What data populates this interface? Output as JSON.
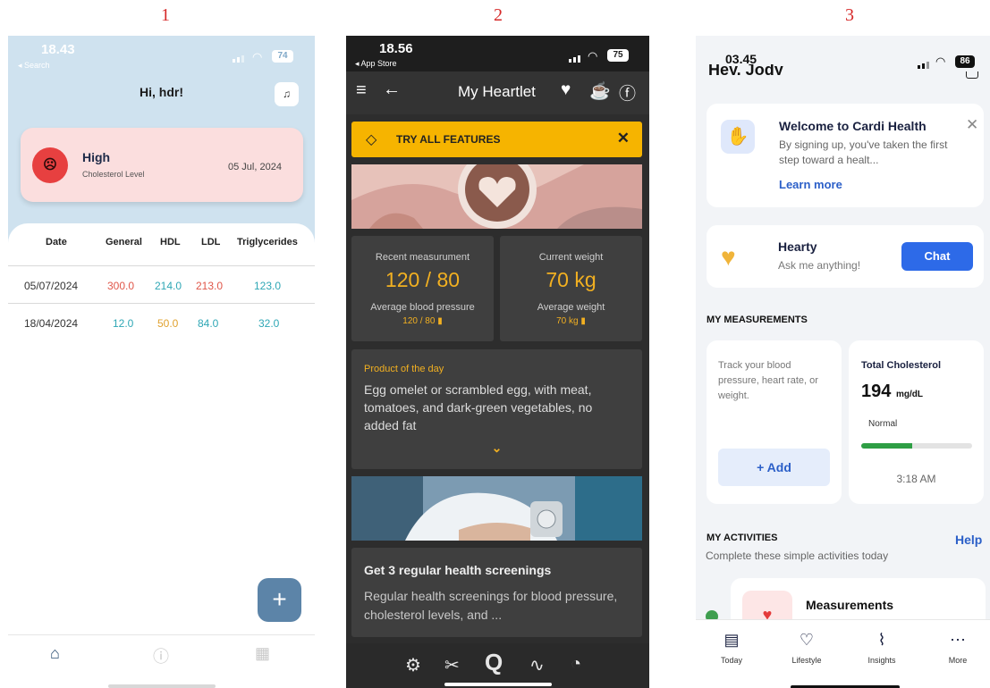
{
  "labels": [
    "1",
    "2",
    "3"
  ],
  "phone1": {
    "time": "18.43",
    "back_label": "◂ Search",
    "battery": "74",
    "greeting": "Hi, hdr!",
    "status_card": {
      "level": "High",
      "label": "Cholesterol Level",
      "date": "05 Jul, 2024"
    },
    "table": {
      "headers": [
        "Date",
        "General",
        "HDL",
        "LDL",
        "Triglycerides"
      ],
      "rows": [
        [
          "05/07/2024",
          "300.0",
          "214.0",
          "213.0",
          "123.0"
        ],
        [
          "18/04/2024",
          "12.0",
          "50.0",
          "84.0",
          "32.0"
        ]
      ]
    },
    "fab_label": "+",
    "colors": {
      "header_bg": "#cfe2ef",
      "card_bg": "#fbdede",
      "fab": "#5c84a8"
    }
  },
  "phone2": {
    "time": "18.56",
    "back_label": "◂ App Store",
    "battery": "75",
    "title": "My Heartlet",
    "promo": "TRY ALL FEATURES",
    "tiles": [
      {
        "label": "Recent measurument",
        "value": "120 / 80",
        "sub_label": "Average blood pressure",
        "sub_value": "120 / 80 ▮"
      },
      {
        "label": "Current weight",
        "value": "70 kg",
        "sub_label": "Average weight",
        "sub_value": "70 kg ▮"
      }
    ],
    "product": {
      "label": "Product of the day",
      "text": "Egg omelet or scrambled egg, with meat, tomatoes, and dark-green vegetables, no added fat"
    },
    "tip": {
      "title": "Get 3 regular health screenings",
      "body": "Regular health screenings for blood pressure, cholesterol levels, and ..."
    },
    "colors": {
      "bg": "#2d2d2d",
      "accent": "#f2b021",
      "promo": "#f6b400"
    }
  },
  "phone3": {
    "time": "03.45",
    "battery": "86",
    "cut_greeting": "Hey, Jody",
    "welcome": {
      "title": "Welcome to Cardi Health",
      "body": "By signing up, you've taken the first step toward a healt...",
      "link": "Learn more"
    },
    "hearty": {
      "title": "Hearty",
      "sub": "Ask me anything!",
      "button": "Chat"
    },
    "measurements": {
      "heading": "MY MEASUREMENTS",
      "track_text": "Track your blood pressure, heart rate, or weight.",
      "add_label": "+ Add",
      "cholesterol": {
        "title": "Total Cholesterol",
        "value": "194",
        "unit": "mg/dL",
        "status": "Normal",
        "level": 0.46,
        "time": "3:18 AM"
      }
    },
    "activities": {
      "heading": "MY ACTIVITIES",
      "help": "Help",
      "subtitle": "Complete these simple activities today",
      "item": "Measurements"
    },
    "tabs": [
      "Today",
      "Lifestyle",
      "Insights",
      "More"
    ],
    "colors": {
      "bg": "#f2f4f7",
      "primary": "#2d6ae8",
      "link": "#2b5fc8",
      "progress": "#2e9e44"
    }
  }
}
